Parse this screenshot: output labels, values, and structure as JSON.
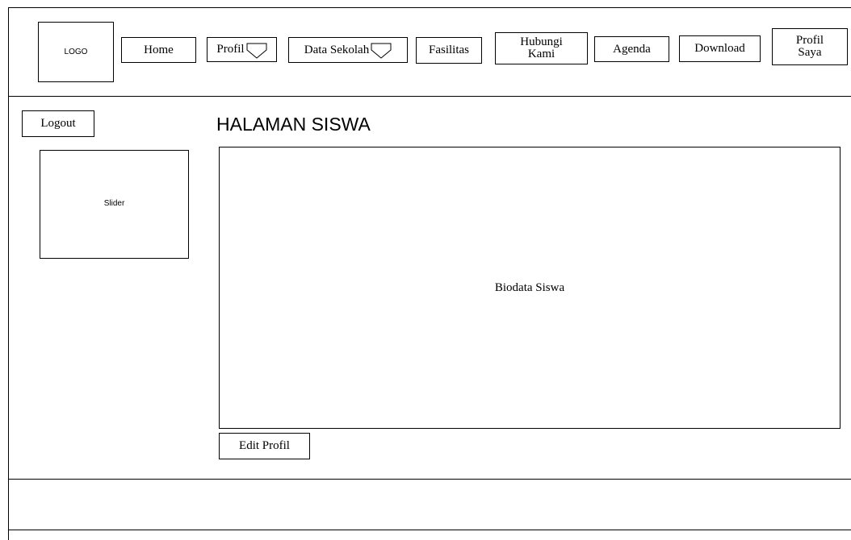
{
  "header": {
    "logo_label": "LOGO",
    "nav": {
      "home": "Home",
      "profil": "Profil",
      "data_sekolah": "Data Sekolah",
      "fasilitas": "Fasilitas",
      "hubungi_kami": "Hubungi\nKami",
      "agenda": "Agenda",
      "download": "Download",
      "profil_saya": "Profil\nSaya"
    }
  },
  "sidebar": {
    "logout_label": "Logout",
    "slider_label": "Slider"
  },
  "main": {
    "page_title": "HALAMAN SISWA",
    "biodata_label": "Biodata Siswa",
    "edit_profil_label": "Edit Profil"
  }
}
